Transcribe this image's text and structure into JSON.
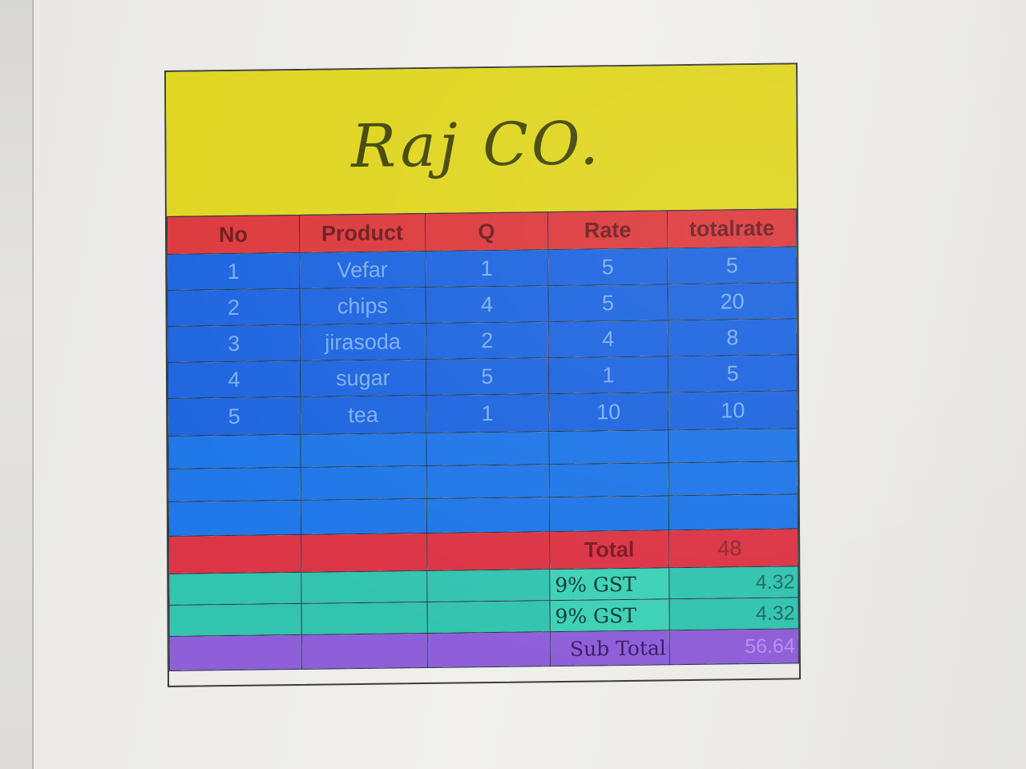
{
  "title": "Raj CO.",
  "table": {
    "headers": [
      "No",
      "Product",
      "Q",
      "Rate",
      "totalrate"
    ],
    "rows": [
      {
        "no": "1",
        "product": "Vefar",
        "q": "1",
        "rate": "5",
        "total": "5"
      },
      {
        "no": "2",
        "product": "chips",
        "q": "4",
        "rate": "5",
        "total": "20"
      },
      {
        "no": "3",
        "product": "jirasoda",
        "q": "2",
        "rate": "4",
        "total": "8"
      },
      {
        "no": "4",
        "product": "sugar",
        "q": "5",
        "rate": "1",
        "total": "5"
      },
      {
        "no": "5",
        "product": "tea",
        "q": "1",
        "rate": "10",
        "total": "10"
      }
    ]
  },
  "summary": {
    "total_label": "Total",
    "total_value": "48",
    "gst1_label": "9% GST",
    "gst1_value": "4.32",
    "gst2_label": "9% GST",
    "gst2_value": "4.32",
    "subtotal_label": "Sub Total",
    "subtotal_value": "56.64"
  },
  "colors": {
    "title_band": "#e0d622",
    "header_row": "#dd3b3e",
    "item_rows": "#1f66e0",
    "total_row": "#dc3546",
    "gst_rows": "#33c4b0",
    "subtotal_row": "#8f5fd9"
  }
}
